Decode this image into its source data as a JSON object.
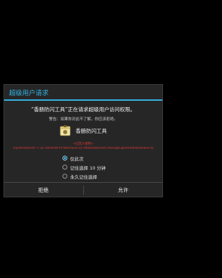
{
  "dialog": {
    "title": "超级用户请求",
    "message": "“香肠防闪工具”正在请求超级用户访问权限。",
    "warning": "警告：如果你对此不了解，你应该拒绝。",
    "app": {
      "icon": "app-package-icon",
      "name": "香肠防闪工具"
    },
    "red_text": {
      "line1": "<已无人使用>",
      "line2": "/system/bin/sh -c cp /sdcard/FXY/libresave.so /data/data/com.sausage.game/lib/libresave.so"
    },
    "options": [
      {
        "label": "仅此次",
        "checked": true
      },
      {
        "label": "记住选择 10 分钟",
        "checked": false
      },
      {
        "label": "永久记住选择",
        "checked": false
      }
    ],
    "buttons": {
      "deny": "拒绝",
      "allow": "允许"
    }
  },
  "colors": {
    "accent": "#33b5e5",
    "dialog_bg": "#262626",
    "red_text": "#e53935"
  }
}
